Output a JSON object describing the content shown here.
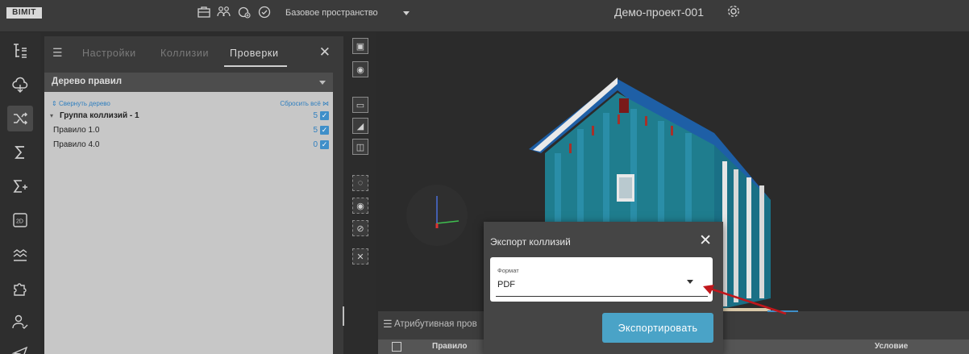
{
  "topbar": {
    "logo": "BIMIT",
    "space_label": "Базовое пространство",
    "project_title": "Демо-проект-001",
    "icons": [
      "briefcase-icon",
      "users-icon",
      "clock-plus-icon",
      "check-circle-icon",
      "gear-icon"
    ]
  },
  "rail": {
    "items": [
      "tree-icon",
      "cloud-icon",
      "shuffle-icon",
      "sigma-icon",
      "sigma-plus-icon",
      "2d-icon",
      "layers-icon",
      "puzzle-icon",
      "user-check-icon",
      "send-icon"
    ],
    "active_index": 2
  },
  "panel": {
    "tabs": [
      {
        "label": "Настройки"
      },
      {
        "label": "Коллизии"
      },
      {
        "label": "Проверки"
      }
    ],
    "active_tab": 2,
    "tree_select": "Дерево правил",
    "collapse_label": "Свернуть дерево",
    "reset_label": "Сбросить всё",
    "rows": [
      {
        "name": "Группа коллизий - 1",
        "count": "5",
        "checked": true
      },
      {
        "name": "Правило 1.0",
        "count": "5",
        "checked": true
      },
      {
        "name": "Правило 4.0",
        "count": "0",
        "checked": true
      }
    ]
  },
  "viewport_tools": [
    "frame-icon",
    "target-icon",
    "camera-icon",
    "section-icon",
    "box-icon",
    "cube-dashed-icon",
    "eye-icon",
    "eye-off-icon",
    "close-box-icon"
  ],
  "attr_panel": {
    "title": "Атрибутивная пров",
    "col_rule": "Правило",
    "col_condition": "Условие"
  },
  "modal": {
    "title": "Экспорт коллизий",
    "field_label": "Формат",
    "field_value": "PDF",
    "export_label": "Экспортировать"
  },
  "colors": {
    "accent": "#4aa3c7",
    "link": "#2f7fbf",
    "arrow": "#c0171c"
  }
}
